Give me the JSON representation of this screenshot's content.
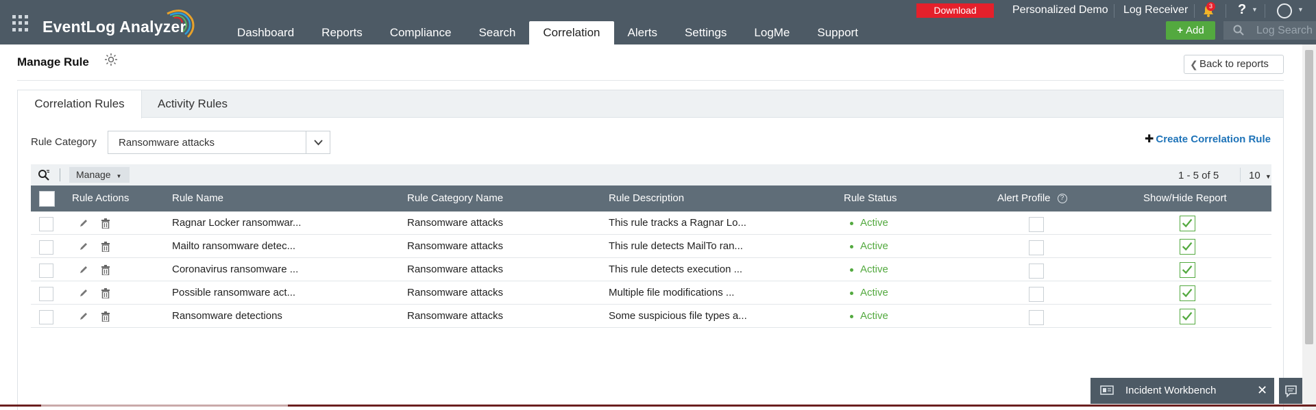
{
  "app": {
    "name": "EventLog Analyzer"
  },
  "nav": {
    "items": [
      "Dashboard",
      "Reports",
      "Compliance",
      "Search",
      "Correlation",
      "Alerts",
      "Settings",
      "LogMe",
      "Support"
    ],
    "active": "Correlation"
  },
  "topbar": {
    "download_label": "Download",
    "personalized_demo": "Personalized Demo",
    "log_receiver": "Log Receiver",
    "notification_count": "3",
    "help_label": "?",
    "add_label": "Add",
    "log_search_placeholder": "Log Search"
  },
  "page": {
    "title": "Manage Rule",
    "back_label": "Back to reports"
  },
  "tabs": [
    {
      "label": "Correlation Rules",
      "active": true
    },
    {
      "label": "Activity Rules",
      "active": false
    }
  ],
  "filter": {
    "rule_category_label": "Rule Category",
    "rule_category_value": "Ransomware attacks",
    "create_label": "Create Correlation Rule"
  },
  "toolbar": {
    "manage_label": "Manage",
    "pager": "1 - 5 of 5",
    "page_size": "10"
  },
  "table": {
    "columns": [
      "Rule Actions",
      "Rule Name",
      "Rule Category Name",
      "Rule Description",
      "Rule Status",
      "Alert Profile",
      "Show/Hide Report"
    ],
    "rows": [
      {
        "name": "Ragnar Locker ransomwar...",
        "category": "Ransomware attacks",
        "description": "This rule tracks a Ragnar Lo...",
        "status": "Active",
        "alert_profile": false,
        "show_report": true
      },
      {
        "name": "Mailto ransomware detec...",
        "category": "Ransomware attacks",
        "description": "This rule detects MailTo ran...",
        "status": "Active",
        "alert_profile": false,
        "show_report": true
      },
      {
        "name": "Coronavirus ransomware ...",
        "category": "Ransomware attacks",
        "description": "This rule detects execution ...",
        "status": "Active",
        "alert_profile": false,
        "show_report": true
      },
      {
        "name": "Possible ransomware act...",
        "category": "Ransomware attacks",
        "description": "Multiple file modifications ...",
        "status": "Active",
        "alert_profile": false,
        "show_report": true
      },
      {
        "name": "Ransomware detections",
        "category": "Ransomware attacks",
        "description": "Some suspicious file types a...",
        "status": "Active",
        "alert_profile": false,
        "show_report": true
      }
    ]
  },
  "workbench": {
    "label": "Incident Workbench"
  },
  "colors": {
    "topbar": "#4d5a65",
    "accent_green": "#53a93f",
    "download_red": "#e5202b",
    "link_blue": "#1e73b8",
    "table_header": "#5f6d78"
  },
  "icons": [
    "apps-grid-icon",
    "bell-icon",
    "help-icon",
    "user-icon",
    "plus-icon",
    "search-icon",
    "bulb-icon",
    "chevron-left-icon",
    "chevron-down-icon",
    "filter-search-icon",
    "edit-icon",
    "trash-icon",
    "check-icon",
    "workbench-icon",
    "close-icon",
    "chat-icon"
  ]
}
